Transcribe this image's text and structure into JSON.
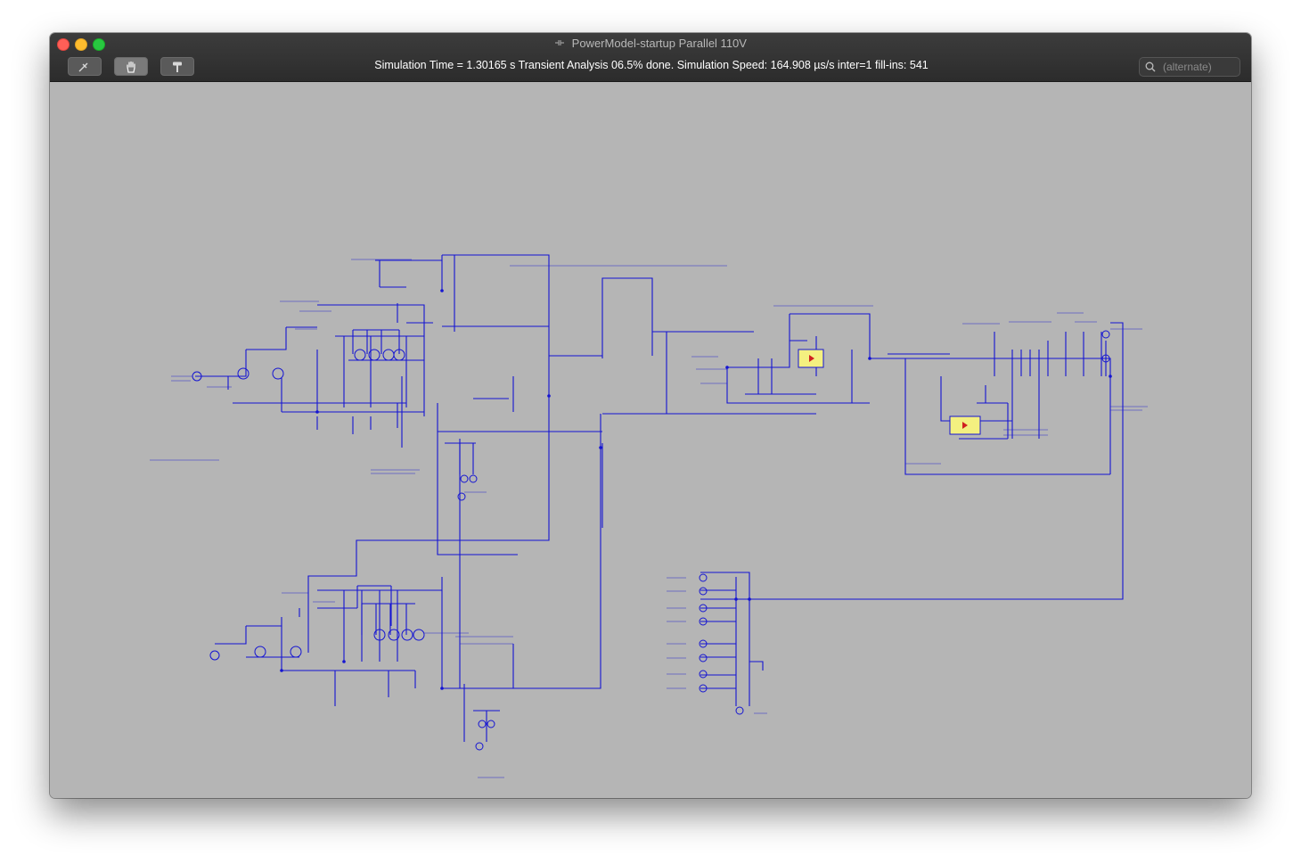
{
  "window": {
    "title": "PowerModel-startup Parallel 110V"
  },
  "toolbar": {
    "tools": [
      {
        "icon": "probe-icon"
      },
      {
        "icon": "hand-icon"
      },
      {
        "icon": "hammer-icon"
      }
    ],
    "status_text": "Simulation Time = 1.30165 s  Transient Analysis 06.5% done. Simulation Speed: 164.908 µs/s inter=1 fill-ins: 541",
    "search_placeholder": "(alternate)"
  },
  "colors": {
    "schematic_wire": "#1414d2",
    "canvas_background": "#b5b5b5",
    "component_highlight": "#f4f080"
  }
}
